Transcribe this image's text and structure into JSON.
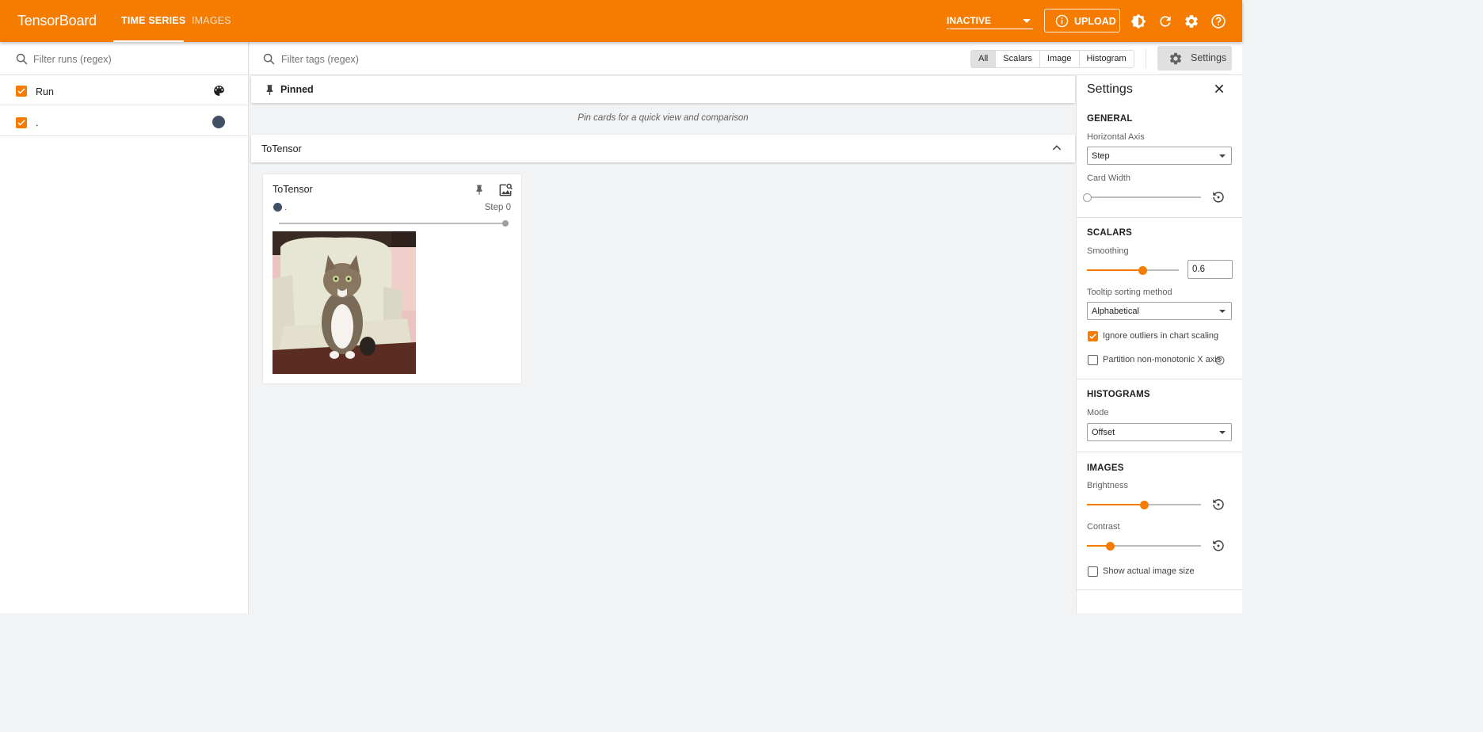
{
  "topbar": {
    "brand": "TensorBoard",
    "tabs": [
      {
        "label": "TIME SERIES",
        "active": true
      },
      {
        "label": "IMAGES",
        "active": false
      }
    ],
    "reload_status": "INACTIVE",
    "upload_label": "UPLOAD",
    "accent_color": "#f57c00"
  },
  "runs": {
    "filter_placeholder": "Filter runs (regex)",
    "header_label": "Run",
    "items": [
      {
        "label": ".",
        "checked": true,
        "color": "#425066"
      }
    ]
  },
  "main": {
    "tags_filter_placeholder": "Filter tags (regex)",
    "type_filters": [
      {
        "label": "All",
        "active": true
      },
      {
        "label": "Scalars"
      },
      {
        "label": "Image"
      },
      {
        "label": "Histogram"
      }
    ],
    "settings_button_label": "Settings",
    "pinned_label": "Pinned",
    "pinned_hint": "Pin cards for a quick view and comparison",
    "group_label": "ToTensor",
    "card": {
      "title": "ToTensor",
      "run_label": ".",
      "step_label": "Step 0",
      "image_description": "cat-on-chair-image"
    }
  },
  "settings": {
    "title": "Settings",
    "general": {
      "title": "GENERAL",
      "horizontal_axis_label": "Horizontal Axis",
      "horizontal_axis_value": "Step",
      "card_width_label": "Card Width",
      "card_width_level": 0
    },
    "scalars": {
      "title": "SCALARS",
      "smoothing_label": "Smoothing",
      "smoothing_value": "0.6",
      "smoothing_level": 0.6,
      "tooltip_sort_label": "Tooltip sorting method",
      "tooltip_sort_value": "Alphabetical",
      "ignore_outliers_label": "Ignore outliers in chart scaling",
      "ignore_outliers_checked": true,
      "partition_label": "Partition non-monotonic X axis",
      "partition_checked": false
    },
    "histograms": {
      "title": "HISTOGRAMS",
      "mode_label": "Mode",
      "mode_value": "Offset"
    },
    "images": {
      "title": "IMAGES",
      "brightness_label": "Brightness",
      "brightness_level": 0.5,
      "contrast_label": "Contrast",
      "contrast_level": 0.2,
      "actual_size_label": "Show actual image size",
      "actual_size_checked": false
    }
  }
}
